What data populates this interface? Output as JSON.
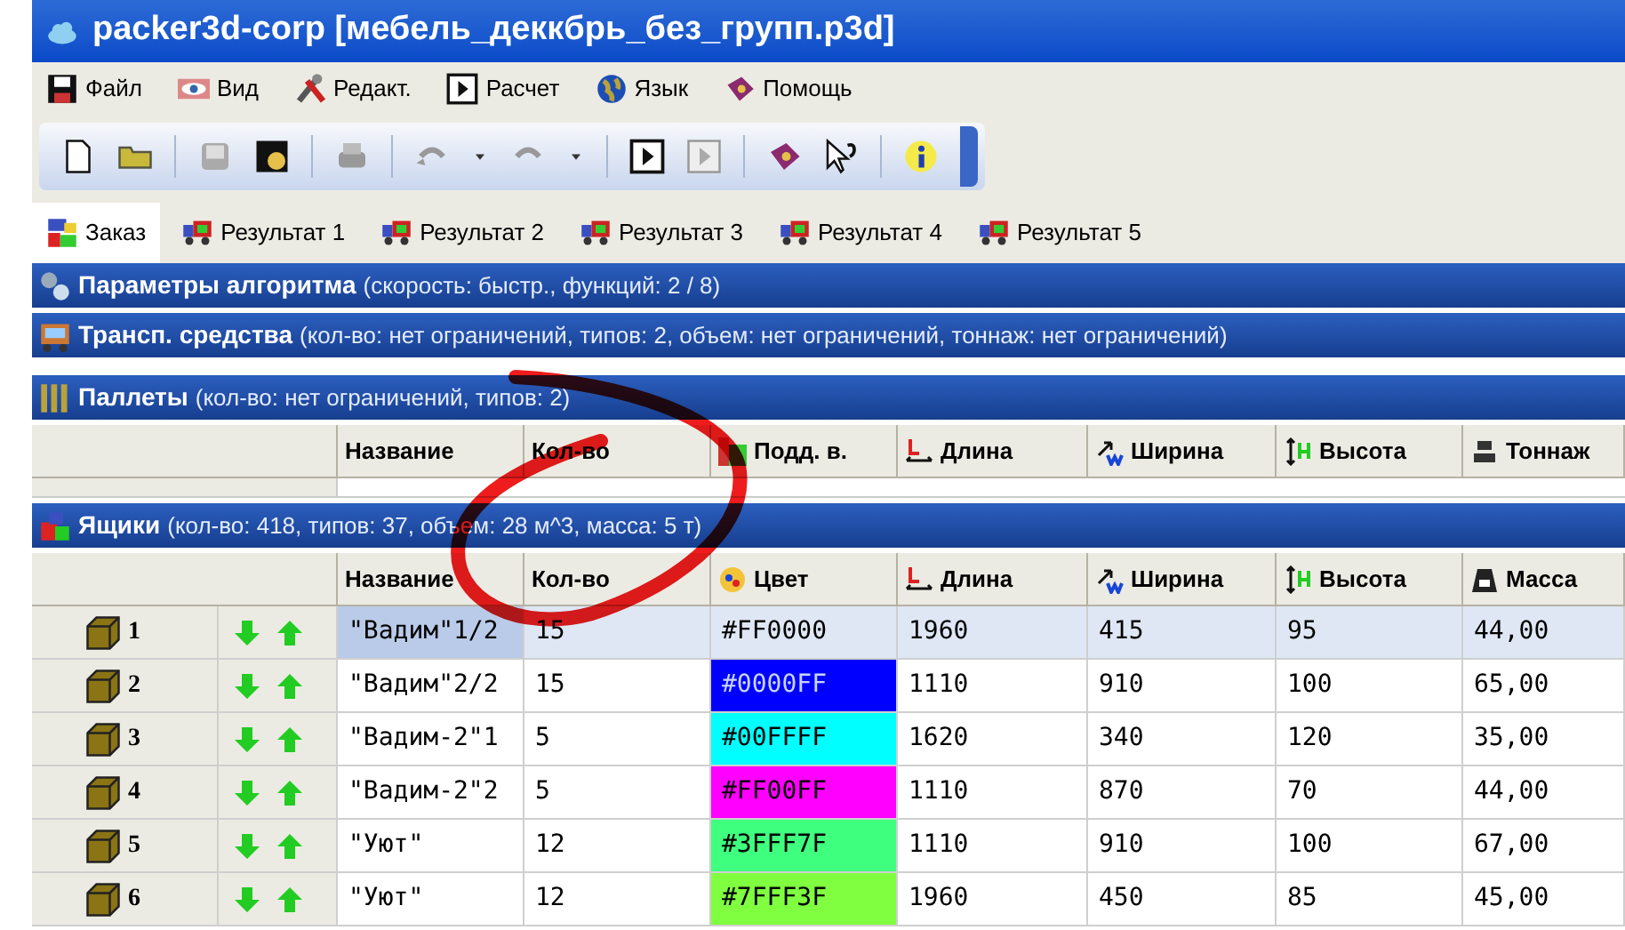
{
  "window": {
    "title": "packer3d-corp [мебель_деккбрь_без_групп.p3d]"
  },
  "menu": [
    {
      "label": "Файл",
      "kind": "file"
    },
    {
      "label": "Вид",
      "kind": "view"
    },
    {
      "label": "Редакт.",
      "kind": "edit"
    },
    {
      "label": "Расчет",
      "kind": "run"
    },
    {
      "label": "Язык",
      "kind": "lang"
    },
    {
      "label": "Помощь",
      "kind": "help"
    }
  ],
  "tabs": [
    {
      "label": "Заказ",
      "selected": true
    },
    {
      "label": "Результат 1",
      "selected": false
    },
    {
      "label": "Результат 2",
      "selected": false
    },
    {
      "label": "Результат 3",
      "selected": false
    },
    {
      "label": "Результат 4",
      "selected": false
    },
    {
      "label": "Результат 5",
      "selected": false
    }
  ],
  "algorithm": {
    "title": "Параметры алгоритма",
    "summary": "(скорость: быстр., функций: 2 / 8)"
  },
  "transport": {
    "title": "Трансп. средства",
    "summary": "(кол-во: нет ограничений, типов: 2, объем: нет ограничений, тоннаж: нет ограничений)"
  },
  "pallets": {
    "title": "Паллеты",
    "summary": "(кол-во: нет ограничений, типов: 2)",
    "columns": [
      {
        "label": "Название",
        "kind": "name"
      },
      {
        "label": "Кол-во",
        "kind": "qty"
      },
      {
        "label": "Подд. в.",
        "kind": "pallet"
      },
      {
        "label": "Длина",
        "kind": "length"
      },
      {
        "label": "Ширина",
        "kind": "width"
      },
      {
        "label": "Высота",
        "kind": "height"
      },
      {
        "label": "Тоннаж",
        "kind": "tonnage"
      }
    ]
  },
  "boxes": {
    "title": "Ящики",
    "summary": "(кол-во: 418, типов: 37, объем: 28 м^3, масса: 5 т)",
    "columns": [
      {
        "label": "Название",
        "kind": "name"
      },
      {
        "label": "Кол-во",
        "kind": "qty"
      },
      {
        "label": "Цвет",
        "kind": "color"
      },
      {
        "label": "Длина",
        "kind": "length"
      },
      {
        "label": "Ширина",
        "kind": "width"
      },
      {
        "label": "Высота",
        "kind": "height"
      },
      {
        "label": "Масса",
        "kind": "mass"
      }
    ],
    "rows": [
      {
        "number": "1",
        "selected": true,
        "cells": [
          "\"Вадим\"1/2",
          "15",
          "#FF0000",
          "1960",
          "415",
          "95",
          "44,00"
        ]
      },
      {
        "number": "2",
        "selected": false,
        "color": "#0000ff",
        "cells": [
          "\"Вадим\"2/2",
          "15",
          "#0000FF",
          "1110",
          "910",
          "100",
          "65,00"
        ]
      },
      {
        "number": "3",
        "selected": false,
        "color": "#00ffff",
        "cells": [
          "\"Вадим-2\"1",
          "5",
          "#00FFFF",
          "1620",
          "340",
          "120",
          "35,00"
        ]
      },
      {
        "number": "4",
        "selected": false,
        "color": "#ff00ff",
        "cells": [
          "\"Вадим-2\"2",
          "5",
          "#FF00FF",
          "1110",
          "870",
          "70",
          "44,00"
        ]
      },
      {
        "number": "5",
        "selected": false,
        "color": "#3fff7f",
        "cells": [
          "\"Уют\"",
          "12",
          "#3FFF7F",
          "1110",
          "910",
          "100",
          "67,00"
        ]
      },
      {
        "number": "6",
        "selected": false,
        "color": "#7fff3f",
        "cells": [
          "\"Уют\"",
          "12",
          "#7FFF3F",
          "1960",
          "450",
          "85",
          "45,00"
        ]
      }
    ]
  }
}
